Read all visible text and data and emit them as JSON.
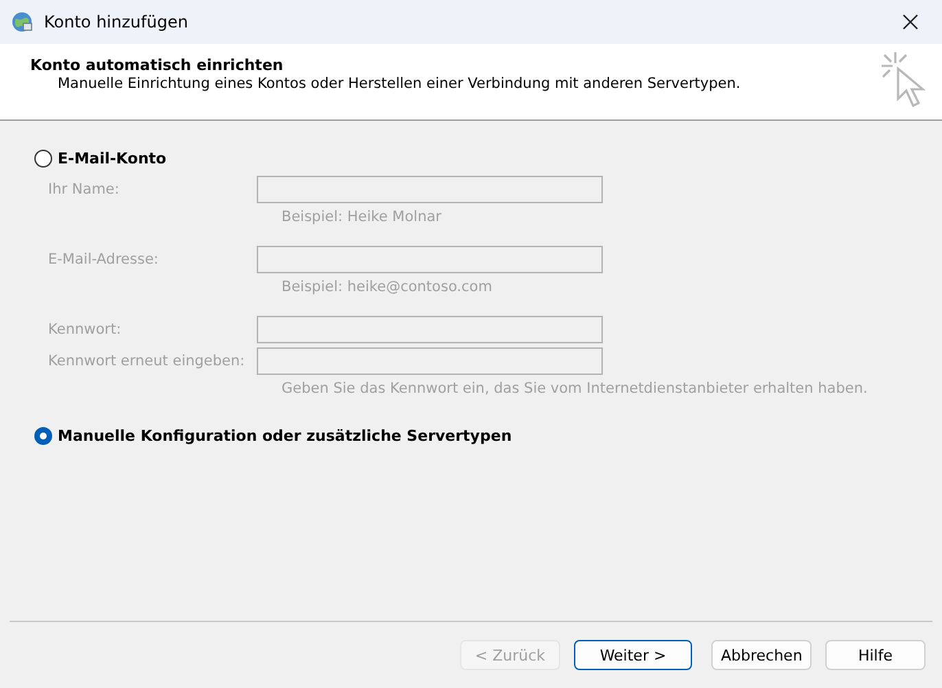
{
  "window": {
    "title": "Konto hinzufügen"
  },
  "header": {
    "title": "Konto automatisch einrichten",
    "subtitle": "Manuelle Einrichtung eines Kontos oder Herstellen einer Verbindung mit anderen Servertypen."
  },
  "options": [
    {
      "kind": "form",
      "label": "E-Mail-Konto",
      "selected": false,
      "fields": [
        {
          "label": "Ihr Name:",
          "disabled": true,
          "hint": "Beispiel: Heike Molnar"
        },
        {
          "label": "E-Mail-Adresse:",
          "disabled": true,
          "hint": "Beispiel: heike@contoso.com"
        },
        {
          "label": "Kennwort:",
          "disabled": true
        },
        {
          "label": "Kennwort erneut eingeben:",
          "disabled": true,
          "hint": "Geben Sie das Kennwort ein, das Sie vom Internetdienstanbieter erhalten haben."
        }
      ]
    },
    {
      "kind": "plain",
      "label": "Manuelle Konfiguration oder zusätzliche Servertypen",
      "selected": true
    }
  ],
  "buttons": [
    {
      "label": "< Zurück",
      "disabled": true,
      "default": false
    },
    {
      "label": "Weiter >",
      "disabled": false,
      "default": true
    },
    {
      "label": "Abbrechen",
      "disabled": false,
      "default": false
    },
    {
      "label": "Hilfe",
      "disabled": false,
      "default": false
    }
  ]
}
